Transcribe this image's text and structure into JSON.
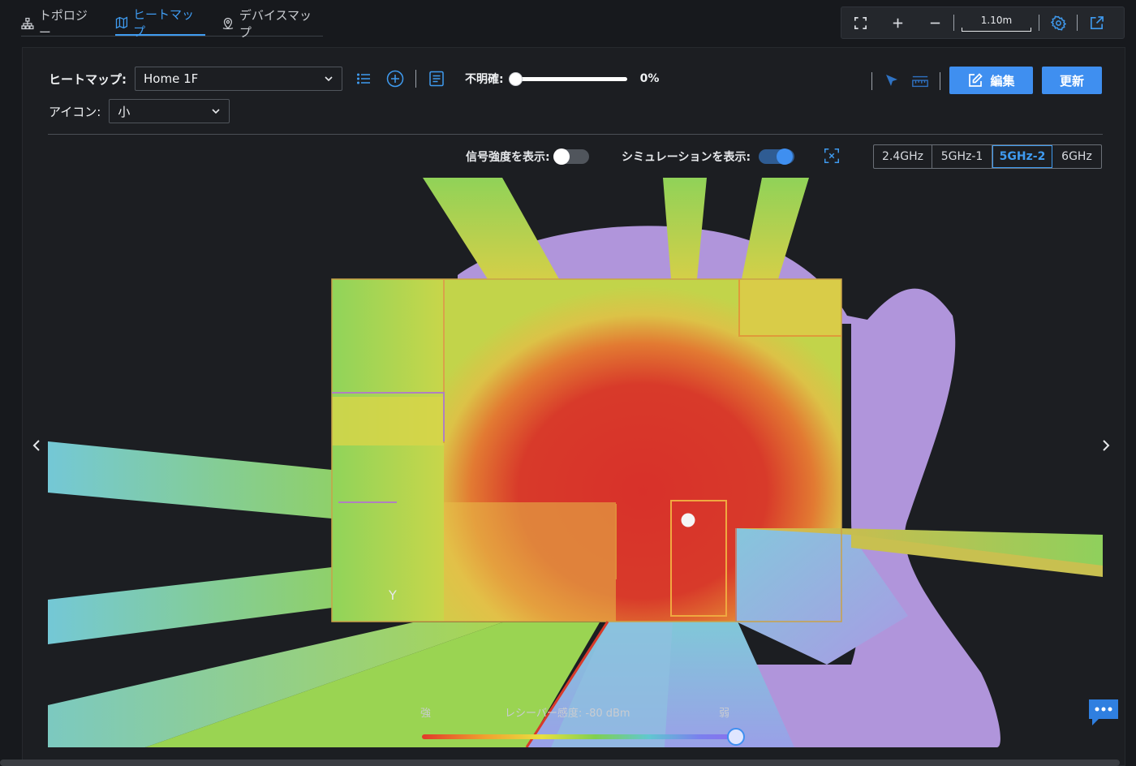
{
  "tabs": [
    {
      "label": "トポロジー",
      "icon": "topology-icon",
      "active": false
    },
    {
      "label": "ヒートマップ",
      "icon": "map-icon",
      "active": true
    },
    {
      "label": "デバイスマップ",
      "icon": "location-pin-icon",
      "active": false
    }
  ],
  "toolbar": {
    "scale_label": "1.10m",
    "icons": [
      "fullscreen-icon",
      "zoom-in-icon",
      "zoom-out-icon",
      "gear-icon",
      "external-link-icon"
    ]
  },
  "controls": {
    "heatmap_label": "ヒートマップ:",
    "heatmap_value": "Home 1F",
    "opacity_label": "不明確:",
    "opacity_value": "0%",
    "edit_label": "編集",
    "update_label": "更新",
    "icon_label": "アイコン:",
    "icon_size_value": "小"
  },
  "display": {
    "signal_label": "信号強度を表示:",
    "signal_on": false,
    "sim_label": "シミュレーションを表示:",
    "sim_on": true
  },
  "bands": [
    {
      "label": "2.4GHz",
      "active": false
    },
    {
      "label": "5GHz-1",
      "active": false
    },
    {
      "label": "5GHz-2",
      "active": true
    },
    {
      "label": "6GHz",
      "active": false
    }
  ],
  "legend": {
    "strong_label": "強",
    "sensitivity_label": "レシーバー感度: -80 dBm",
    "weak_label": "弱"
  },
  "colors": {
    "accent": "#3f8ff0",
    "background": "#17191d",
    "panel": "#1c1e22"
  }
}
